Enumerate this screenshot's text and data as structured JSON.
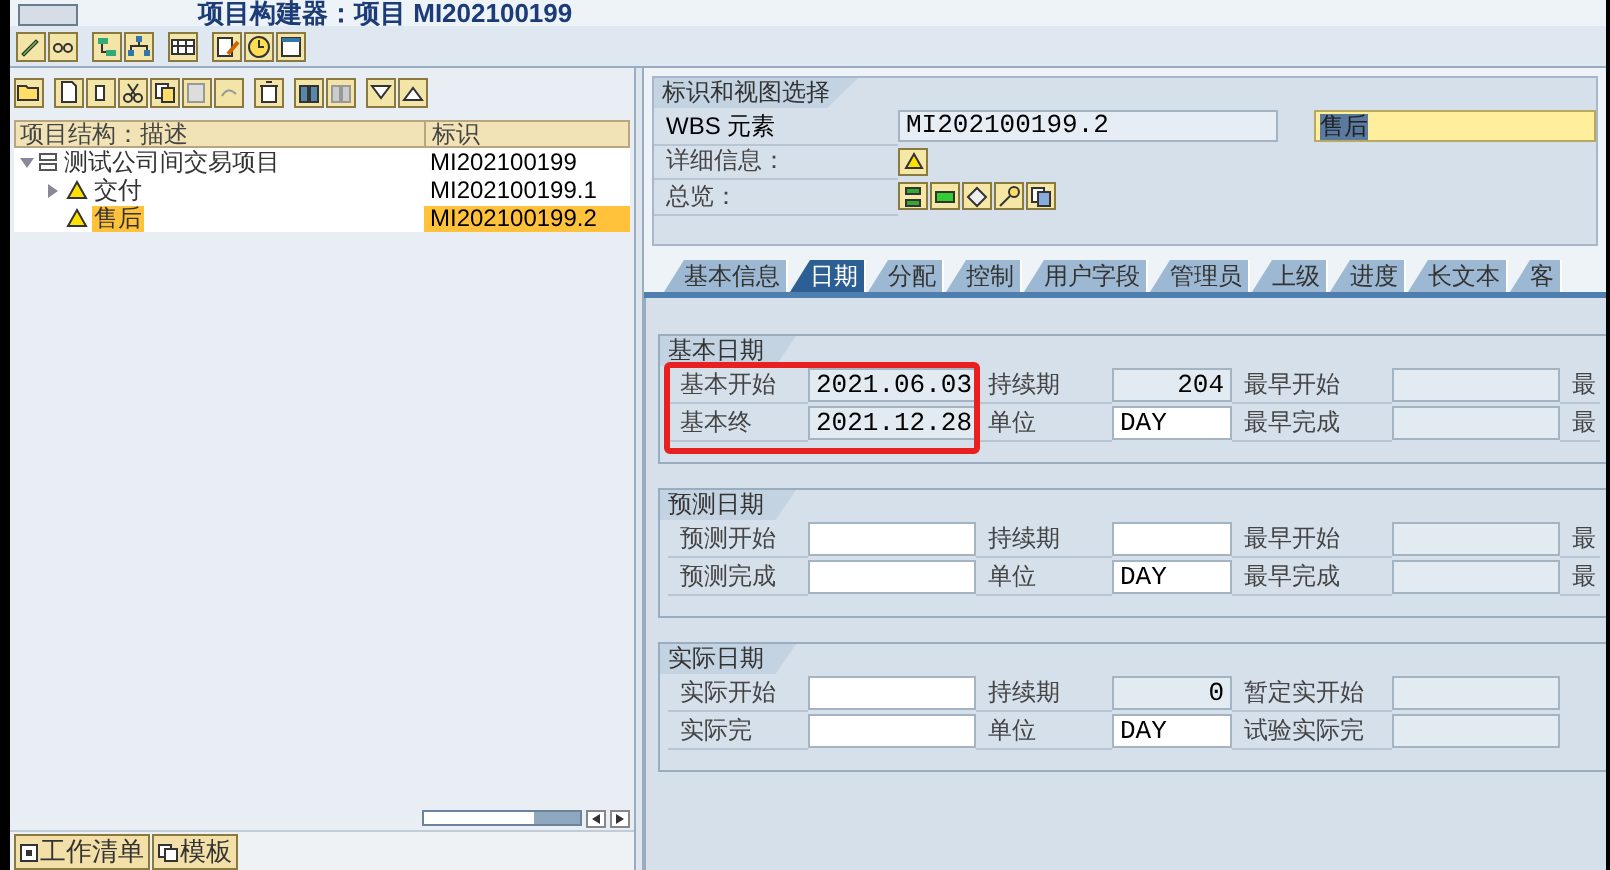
{
  "title": "项目构建器：项目 MI202100199",
  "tree": {
    "columns": [
      "项目结构：描述",
      "标识"
    ],
    "rows": [
      {
        "label": "测试公司间交易项目",
        "id": "MI202100199",
        "kind": "project",
        "expanded": true,
        "selected": false,
        "children": [
          {
            "label": "交付",
            "id": "MI202100199.1",
            "kind": "wbs",
            "expanded": false,
            "selected": false
          },
          {
            "label": "售后",
            "id": "MI202100199.2",
            "kind": "wbs",
            "selected": true
          }
        ]
      }
    ]
  },
  "bottom_tabs": [
    "工作清单",
    "模板"
  ],
  "selection": {
    "title": "标识和视图选择",
    "wbs_label": "WBS 元素",
    "wbs_value": "MI202100199.2",
    "description": "售后",
    "detail_label": "详细信息：",
    "overview_label": "总览："
  },
  "tabs": [
    {
      "label": "基本信息",
      "selected": false
    },
    {
      "label": "日期",
      "selected": true
    },
    {
      "label": "分配",
      "selected": false
    },
    {
      "label": "控制",
      "selected": false
    },
    {
      "label": "用户字段",
      "selected": false
    },
    {
      "label": "管理员",
      "selected": false
    },
    {
      "label": "上级",
      "selected": false
    },
    {
      "label": "进度",
      "selected": false
    },
    {
      "label": "长文本",
      "selected": false
    },
    {
      "label": "客",
      "selected": false
    }
  ],
  "groups": [
    {
      "title": "基本日期",
      "annotated": true,
      "rows": [
        [
          {
            "label": "基本开始"
          },
          {
            "value": "2021.06.03",
            "editable": false
          },
          {
            "label": "持续期"
          },
          {
            "value": "204",
            "editable": false,
            "right_aligned": true
          },
          {
            "label": "最早开始"
          },
          {
            "editable": false
          },
          {
            "label": "最"
          }
        ],
        [
          {
            "label": "基本终"
          },
          {
            "value": "2021.12.28",
            "editable": false
          },
          {
            "label": "单位"
          },
          {
            "value": "DAY",
            "editable": true
          },
          {
            "label": "最早完成"
          },
          {
            "editable": false
          },
          {
            "label": "最"
          }
        ]
      ]
    },
    {
      "title": "预测日期",
      "annotated": false,
      "rows": [
        [
          {
            "label": "预测开始"
          },
          {
            "editable": true
          },
          {
            "label": "持续期"
          },
          {
            "editable": true
          },
          {
            "label": "最早开始"
          },
          {
            "editable": false
          },
          {
            "label": "最"
          }
        ],
        [
          {
            "label": "预测完成"
          },
          {
            "editable": true
          },
          {
            "label": "单位"
          },
          {
            "value": "DAY",
            "editable": true
          },
          {
            "label": "最早完成"
          },
          {
            "editable": false
          },
          {
            "label": "最"
          }
        ]
      ]
    },
    {
      "title": "实际日期",
      "annotated": false,
      "rows": [
        [
          {
            "label": "实际开始"
          },
          {
            "editable": true
          },
          {
            "label": "持续期"
          },
          {
            "value": "0",
            "editable": false,
            "right_aligned": true
          },
          {
            "label": "暂定实开始"
          },
          {
            "editable": false
          }
        ],
        [
          {
            "label": "实际完"
          },
          {
            "editable": true
          },
          {
            "label": "单位"
          },
          {
            "value": "DAY",
            "editable": true
          },
          {
            "label": "试验实际完"
          },
          {
            "editable": false
          }
        ]
      ]
    }
  ]
}
